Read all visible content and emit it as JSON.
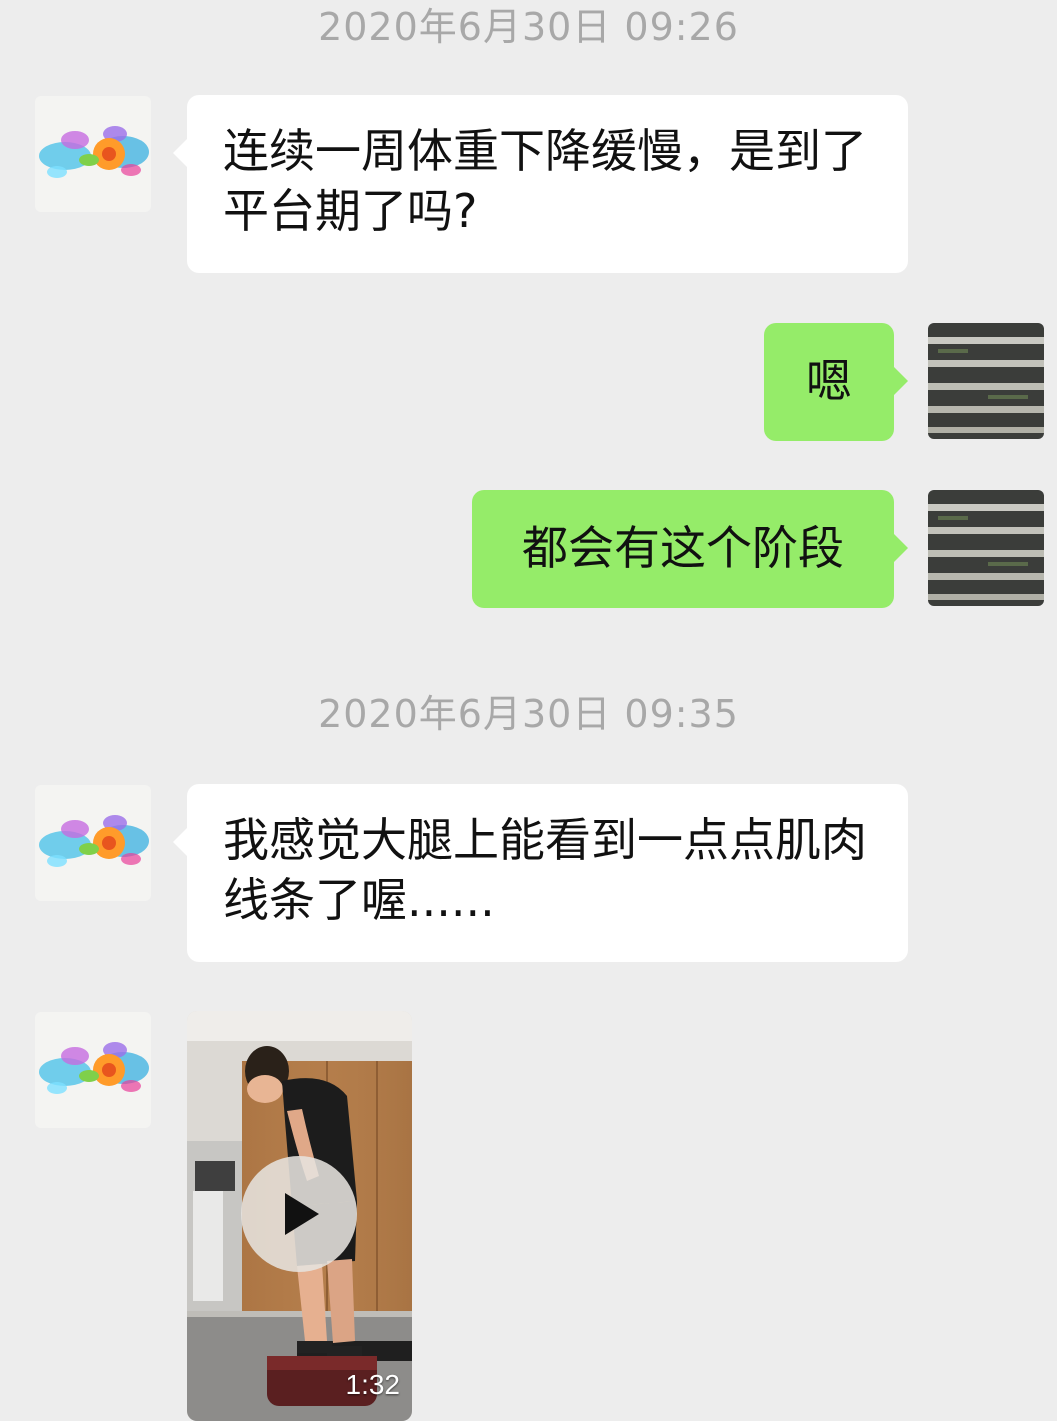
{
  "chat": {
    "timestamp_1": "2020年6月30日 09:26",
    "timestamp_2": "2020年6月30日 09:35",
    "messages": [
      {
        "sender": "contact",
        "type": "text",
        "text": "连续一周体重下降缓慢，是到了平台期了吗?"
      },
      {
        "sender": "me",
        "type": "text",
        "text": "嗯"
      },
      {
        "sender": "me",
        "type": "text",
        "text": "都会有这个阶段"
      },
      {
        "sender": "contact",
        "type": "text",
        "text": "我感觉大腿上能看到一点点肌肉线条了喔......"
      },
      {
        "sender": "contact",
        "type": "video",
        "duration": "1:32"
      }
    ]
  },
  "avatars": {
    "contact": "flower-avatar",
    "me": "stairs-avatar"
  },
  "colors": {
    "background": "#ededed",
    "incoming_bubble": "#ffffff",
    "outgoing_bubble": "#95ec69",
    "timestamp_text": "#a8a8a8"
  }
}
